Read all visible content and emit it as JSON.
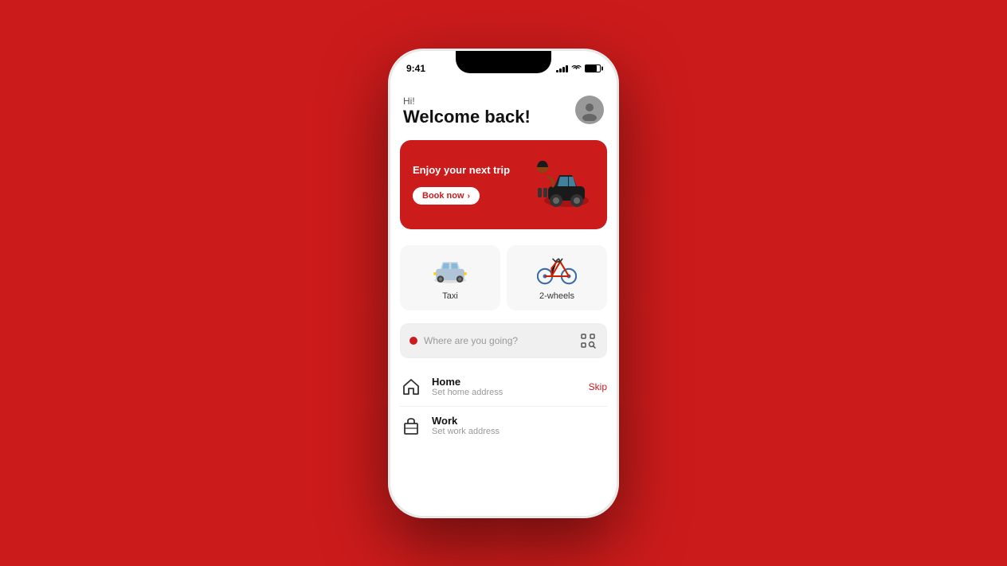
{
  "background": {
    "color": "#CC1B1B"
  },
  "status_bar": {
    "time": "9:41",
    "battery_level": 75
  },
  "header": {
    "greeting": "Hi!",
    "welcome": "Welcome back!",
    "avatar_label": "User avatar"
  },
  "promo": {
    "title": "Enjoy your next trip",
    "button_label": "Book now"
  },
  "services": [
    {
      "label": "Taxi",
      "icon": "taxi-icon"
    },
    {
      "label": "2-wheels",
      "icon": "bike-icon"
    }
  ],
  "search": {
    "placeholder": "Where are you going?",
    "icon": "scan-icon"
  },
  "address_items": [
    {
      "name": "Home",
      "subtitle": "Set home address",
      "icon": "home-icon"
    },
    {
      "name": "Work",
      "subtitle": "Set work address",
      "icon": "work-icon"
    }
  ],
  "skip_label": "Skip"
}
